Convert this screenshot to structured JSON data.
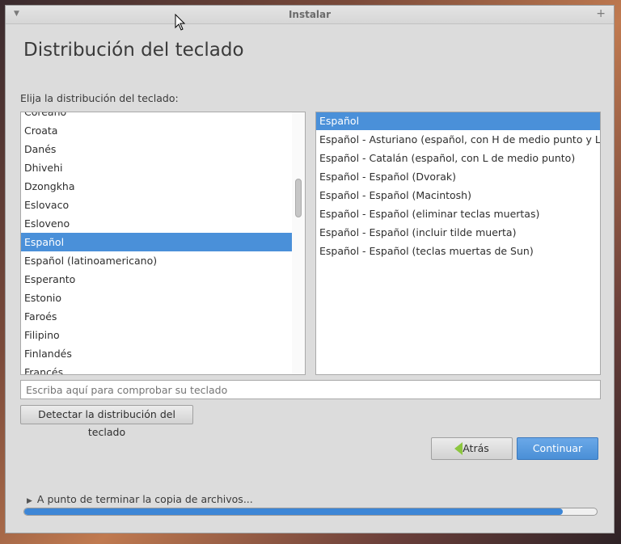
{
  "window": {
    "title": "Instalar"
  },
  "page": {
    "heading": "Distribución del teclado",
    "prompt": "Elija la distribución del teclado:"
  },
  "languages": [
    "Coreano",
    "Croata",
    "Danés",
    "Dhivehi",
    "Dzongkha",
    "Eslovaco",
    "Esloveno",
    "Español",
    "Español (latinoamericano)",
    "Esperanto",
    "Estonio",
    "Faroés",
    "Filipino",
    "Finlandés",
    "Francés"
  ],
  "selected_language": "Español",
  "variants": [
    "Español",
    "Español - Asturiano (español, con H de medio punto y L de",
    "Español - Catalán (español, con L de medio punto)",
    "Español - Español (Dvorak)",
    "Español - Español (Macintosh)",
    "Español - Español (eliminar teclas muertas)",
    "Español - Español (incluir tilde muerta)",
    "Español - Español (teclas muertas de Sun)"
  ],
  "selected_variant": "Español",
  "test_input": {
    "placeholder": "Escriba aquí para comprobar su teclado",
    "value": ""
  },
  "buttons": {
    "detect": "Detectar la distribución del teclado",
    "back": "Atrás",
    "continue": "Continuar"
  },
  "progress": {
    "label": "A punto de terminar la copia de archivos...",
    "value": 0.94
  },
  "colors": {
    "selection": "#4a90d9",
    "progress": "#3d86d6",
    "back_arrow": "#8cc63f"
  }
}
